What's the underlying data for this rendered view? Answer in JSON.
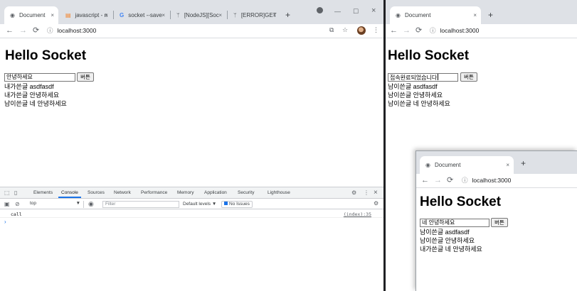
{
  "left_window": {
    "tabs": [
      {
        "label": "Document",
        "icon": "globe-icon"
      },
      {
        "label": "javascript - n",
        "icon": "stackoverflow-icon"
      },
      {
        "label": "socket --save",
        "icon": "google-icon"
      },
      {
        "label": "[NodeJS][Soc",
        "icon": "velog-icon"
      },
      {
        "label": "[ERROR]GET",
        "icon": "velog-icon"
      }
    ],
    "url": "localhost:3000",
    "page": {
      "heading": "Hello Socket",
      "input_value": "안녕하세요",
      "button_label": "버튼",
      "messages": [
        "내가쓴글 asdfasdf",
        "내가쓴글 안녕하세요",
        "남이쓴글 네 안녕하세요"
      ]
    },
    "devtools": {
      "tabs": [
        "Elements",
        "Console",
        "Sources",
        "Network",
        "Performance",
        "Memory",
        "Application",
        "Security",
        "Lighthouse"
      ],
      "active_tab": "Console",
      "context": "top",
      "filter_placeholder": "Filter",
      "levels": "Default levels ▼",
      "issues": "No Issues",
      "log_text": "call",
      "log_source": "(index):35",
      "prompt": "›"
    }
  },
  "right_window": {
    "tab_label": "Document",
    "url": "localhost:3000",
    "page": {
      "heading": "Hello Socket",
      "input_value": "접속완료되었습니다",
      "button_label": "버튼",
      "messages": [
        "남이쓴글 asdfasdf",
        "남이쓴글 안녕하세요",
        "남이쓴글 네 안녕하세요"
      ]
    }
  },
  "third_window": {
    "tab_label": "Document",
    "url": "localhost:3000",
    "page": {
      "heading": "Hello Socket",
      "input_value": "네 안녕하세요",
      "button_label": "버튼",
      "messages": [
        "남이쓴글 asdfasdf",
        "남이쓴글 안녕하세요",
        "내가쓴글 네 안녕하세요"
      ]
    }
  },
  "icons": {
    "close": "×",
    "new_tab": "+",
    "back": "←",
    "forward": "→",
    "reload": "⟳",
    "info": "ⓘ",
    "star": "☆",
    "menu": "⋮",
    "translate": "⧉",
    "minimize": "—",
    "maximize": "☐"
  },
  "colors": {
    "tabbar": "#dee1e6",
    "accent": "#1a73e8"
  }
}
